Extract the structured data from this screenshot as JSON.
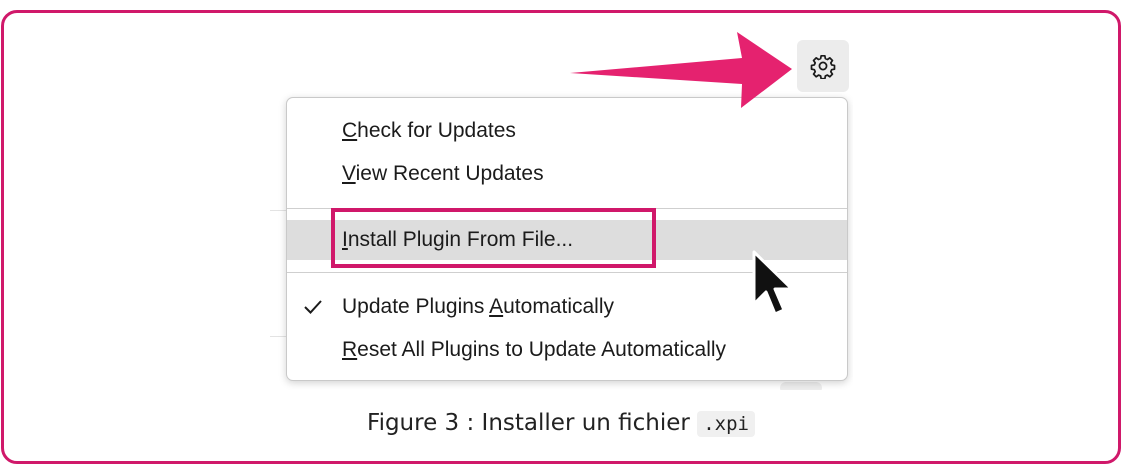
{
  "menu": {
    "items": [
      {
        "label": "Check for Updates",
        "mnemonic": "C",
        "rest": "heck for Updates"
      },
      {
        "label": "View Recent Updates",
        "mnemonic": "V",
        "rest": "iew Recent Updates"
      },
      {
        "label": "Install Plugin From File...",
        "mnemonic": "I",
        "rest": "nstall Plugin From File..."
      },
      {
        "label": "Update Plugins Automatically",
        "before": "Update Plugins ",
        "mnemonic": "A",
        "rest": "utomatically",
        "checked": true
      },
      {
        "label": "Reset All Plugins to Update Automatically",
        "mnemonic": "R",
        "rest": "eset All Plugins to Update Automatically"
      }
    ]
  },
  "caption": {
    "prefix": "Figure 3 : Installer un fichier ",
    "code": ".xpi"
  },
  "icons": {
    "settings": "gear-icon",
    "pointer": "cursor-icon",
    "callout": "arrow-icon",
    "checked": "checkmark-icon"
  },
  "colors": {
    "accent": "#d0186a",
    "highlight": "#dddddd"
  }
}
